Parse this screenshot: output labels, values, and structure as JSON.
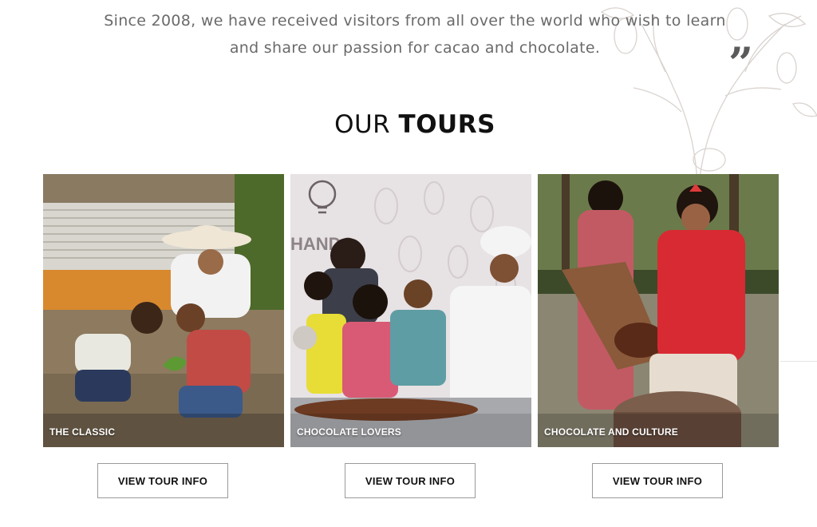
{
  "intro": {
    "line1": "Since 2008, we have received visitors from all over the world who wish to learn",
    "line2": "and share our passion for cacao and chocolate.",
    "quote_mark": "”"
  },
  "section": {
    "title_light": "OUR ",
    "title_bold": "TOURS"
  },
  "tours": [
    {
      "label": "THE CLASSIC",
      "button": "VIEW TOUR INFO"
    },
    {
      "label": "CHOCOLATE LOVERS",
      "button": "VIEW TOUR INFO"
    },
    {
      "label": "CHOCOLATE AND CULTURE",
      "button": "VIEW TOUR INFO"
    }
  ],
  "colors": {
    "text": "#6a6a6a",
    "heading": "#111111",
    "button_border": "#9a9a9a"
  }
}
